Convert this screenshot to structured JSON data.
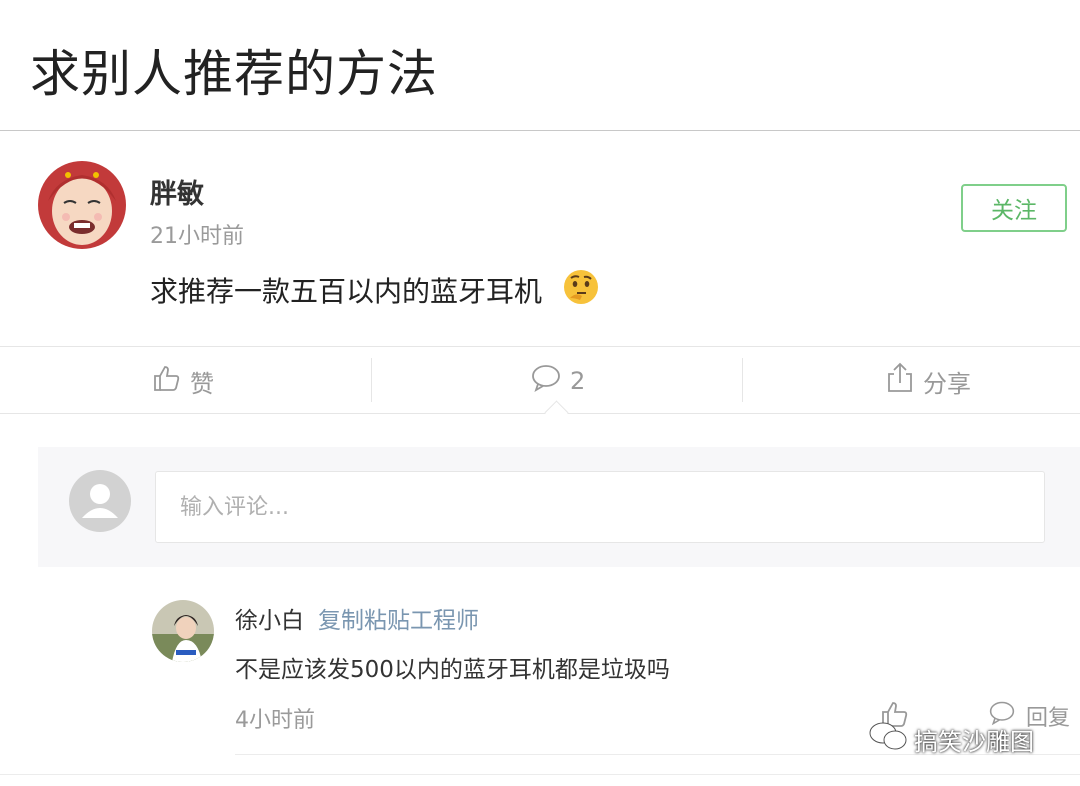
{
  "page": {
    "title": "求别人推荐的方法"
  },
  "post": {
    "author": "胖敏",
    "time": "21小时前",
    "follow_label": "关注",
    "text": "求推荐一款五百以内的蓝牙耳机",
    "emoji": "thinking-face-icon"
  },
  "actions": {
    "like_label": "赞",
    "comment_count": "2",
    "share_label": "分享"
  },
  "comment_input": {
    "placeholder": "输入评论..."
  },
  "reply": {
    "author": "徐小白",
    "author_title": "复制粘贴工程师",
    "text": "不是应该发500以内的蓝牙耳机都是垃圾吗",
    "time": "4小时前",
    "reply_label": "回复"
  },
  "watermark": {
    "text": "搞笑沙雕图"
  },
  "colors": {
    "follow_green": "#5cb767",
    "muted_gray": "#999999",
    "title_blue": "#7a96b0"
  }
}
